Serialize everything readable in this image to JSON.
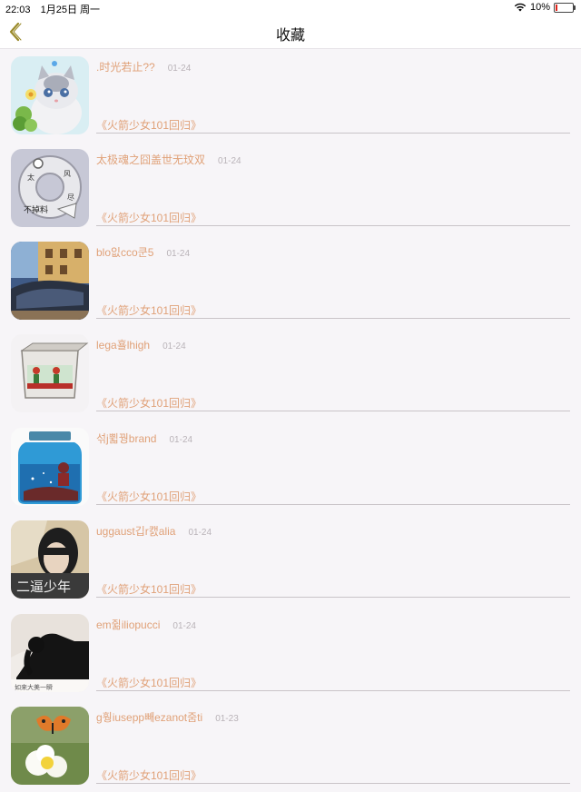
{
  "status_bar": {
    "time": "22:03",
    "date": "1月25日 周一",
    "battery": "10%",
    "battery_level": 0.1
  },
  "nav": {
    "title": "收藏",
    "back_icon": "chevron-left-icon",
    "accent": "#9a8a2a"
  },
  "colors": {
    "name_text": "#e0a178",
    "date_text": "#b9b3b8",
    "background": "#f7f5f8"
  },
  "items": [
    {
      "name": ".时光若止??",
      "date": "01-24",
      "link": "《火箭少女101回归》",
      "image": "white kitten with flower"
    },
    {
      "name": "太极魂之囧盖世无玟双",
      "date": "01-24",
      "link": "《火箭少女101回归》",
      "image": "ring with calligraphy"
    },
    {
      "name": "blo잆cco쿤5",
      "date": "01-24",
      "link": "《火箭少女101回归》",
      "image": "street with car"
    },
    {
      "name": "lega횰lhigh",
      "date": "01-24",
      "link": "《火箭少女101回归》",
      "image": "decorated ceramic box"
    },
    {
      "name": "섞j쀫꿩brand",
      "date": "01-24",
      "link": "《火箭少女101回归》",
      "image": "blue glass jar"
    },
    {
      "name": "uggaust깁r캜alia",
      "date": "01-24",
      "link": "《火箭少女101回归》",
      "image": "boy portrait 二逼少年"
    },
    {
      "name": "em쥚iliopucci",
      "date": "01-24",
      "link": "《火箭少女101回归》",
      "image": "silhouette photo"
    },
    {
      "name": "g훵iusepp빼ezanot줌ti",
      "date": "01-23",
      "link": "《火箭少女101回归》",
      "image": "butterfly on flower"
    }
  ]
}
